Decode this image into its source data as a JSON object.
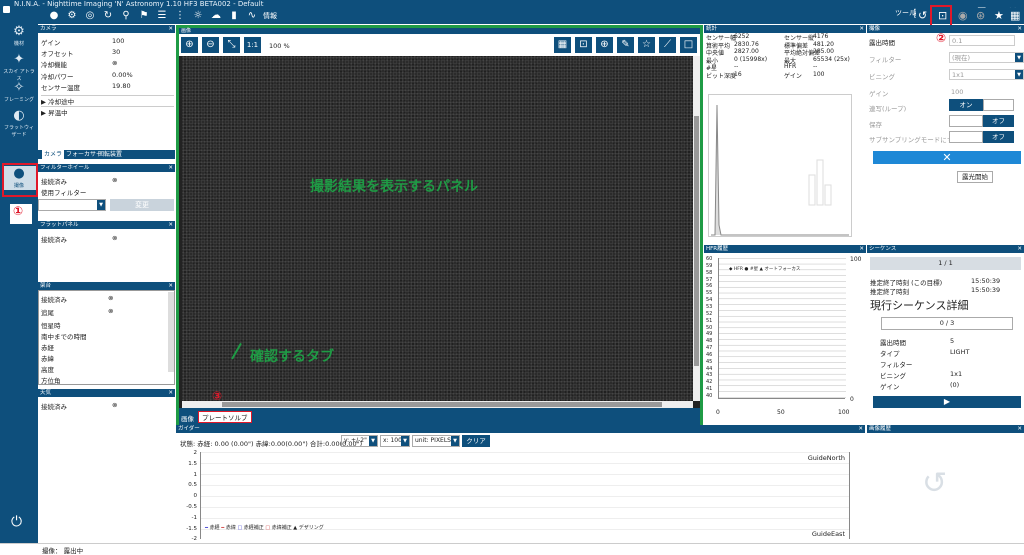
{
  "title": "N.I.N.A. - Nighttime Imaging 'N' Astronomy 1.10 HF3 BETA002  -  Default",
  "toolbar": {
    "info_label": "情報",
    "tool_label": "ツール"
  },
  "sidebar": {
    "items": [
      "機材",
      "スカイ アトラス",
      "フレーミング",
      "フラットウィザード",
      "撮像"
    ]
  },
  "camera": {
    "header": "カメラ",
    "rows": [
      [
        "ゲイン",
        "100"
      ],
      [
        "オフセット",
        "30"
      ],
      [
        "冷却機能",
        "⊗"
      ],
      [
        "冷却パワー",
        "0.00%"
      ],
      [
        "センサー温度",
        "19.80"
      ]
    ],
    "expand1": "冷却途中",
    "expand2": "昇温中",
    "tabs": [
      "カメラ",
      "フォーカサー",
      "回転装置"
    ]
  },
  "filterwheel": {
    "header": "フィルターホイール",
    "connected": "接続済み",
    "use_filter": "使用フィルター",
    "change": "変更"
  },
  "flat": {
    "header": "フラットパネル",
    "connected": "接続済み"
  },
  "telescope": {
    "header": "架台",
    "rows": [
      "接続済み",
      "追尾",
      "恒星時",
      "南中までの時間",
      "赤経",
      "赤緯",
      "高度",
      "方位角"
    ]
  },
  "weather": {
    "header": "天気",
    "connected": "接続済み"
  },
  "image": {
    "header": "画像",
    "zoom": "1:1",
    "zoom_pct": "100 %",
    "annot_panel": "撮影結果を表示するパネル",
    "annot_tab": "確認するタブ",
    "tabs": [
      "画像",
      "プレートソルブ"
    ]
  },
  "stats": {
    "header": "統計",
    "rows": [
      [
        "センサー幅",
        "6252",
        "センサー縦",
        "4176"
      ],
      [
        "算術平均",
        "2830.76",
        "標準偏差",
        "481.20"
      ],
      [
        "中央値",
        "2827.00",
        "平均絶対偏差",
        "285.00"
      ],
      [
        "最小",
        "0 (15998x)",
        "最大",
        "65534 (25x)"
      ],
      [
        "#星",
        "--",
        "HFR",
        "--"
      ],
      [
        "ビット深度",
        "16",
        "ゲイン",
        "100"
      ]
    ]
  },
  "hfr": {
    "header": "HFR履歴",
    "legend": [
      "HFR",
      "#星",
      "オートフォーカス"
    ],
    "y_left": [
      "60",
      "59",
      "58",
      "57",
      "56",
      "55",
      "54",
      "53",
      "52",
      "51",
      "50",
      "49",
      "48",
      "47",
      "46",
      "45",
      "44",
      "43",
      "42",
      "41",
      "40"
    ],
    "y_right_top": "100",
    "y_right_bottom": "0",
    "x_ticks": [
      "0",
      "50",
      "100"
    ]
  },
  "exposure": {
    "header": "撮像",
    "rows": [
      [
        "露出時間",
        "0.1"
      ],
      [
        "フィルター",
        "(現在)"
      ],
      [
        "ビニング",
        "1x1"
      ],
      [
        "ゲイン",
        "100"
      ],
      [
        "連写(ループ)",
        "オン"
      ],
      [
        "保存",
        "オフ"
      ],
      [
        "サブサンプリングモードにする",
        "オフ"
      ]
    ],
    "start": "露光開始"
  },
  "sequence": {
    "header": "シーケンス",
    "progress": "1 / 1",
    "end_today": "推定終了時刻 (この目標)",
    "end_time1": "15:50:39",
    "end_all": "推定終了時刻",
    "end_time2": "15:50:39",
    "detail_title": "現行シーケンス詳細",
    "count": "0 / 3",
    "rows": [
      [
        "露出時間",
        "5"
      ],
      [
        "タイプ",
        "LIGHT"
      ],
      [
        "フィルター",
        ""
      ],
      [
        "ビニング",
        "1x1"
      ],
      [
        "ゲイン",
        "(0)"
      ]
    ]
  },
  "guide": {
    "header": "ガイダー",
    "status": "状態: 赤経: 0.00 (0.00\") 赤緯:0.00(0.00\") 合計:0.00(0.00\")",
    "yrange": "y: +/-2\"",
    "xrange": "x: 100",
    "unit": "unit: PIXELS",
    "clear": "クリア",
    "north": "GuideNorth",
    "east": "GuideEast",
    "y_ticks": [
      "2",
      "1.5",
      "1",
      "0.5",
      "0",
      "-0.5",
      "-1",
      "-1.5",
      "-2"
    ],
    "legend": [
      "赤経",
      "赤緯",
      "赤経補正",
      "赤緯補正",
      "デザリング"
    ]
  },
  "history": {
    "header": "画像履歴"
  },
  "statusbar": {
    "text": "撮像： 露出中"
  },
  "markers": {
    "m1": "①",
    "m2": "②",
    "m3": "③"
  }
}
